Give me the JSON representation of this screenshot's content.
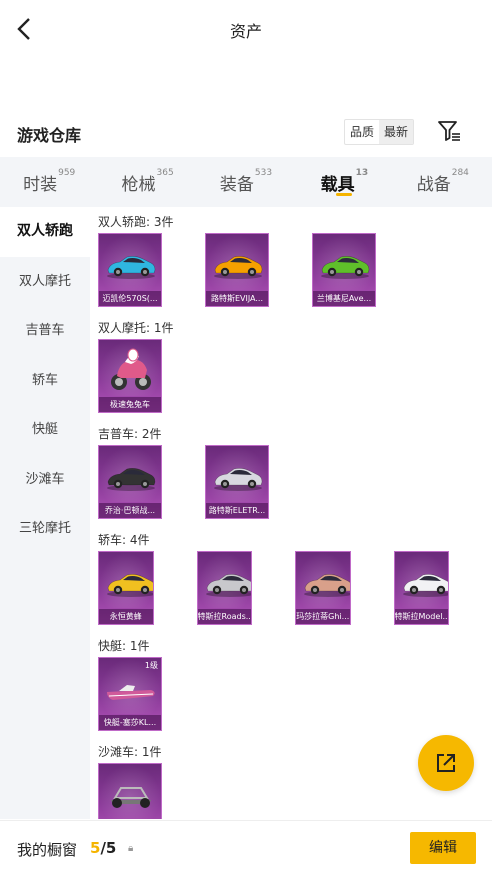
{
  "header": {
    "title": "资产"
  },
  "warehouse": {
    "title": "游戏仓库",
    "sort_options": [
      "品质",
      "最新"
    ]
  },
  "tabs": [
    {
      "label": "时装",
      "count": "959"
    },
    {
      "label": "枪械",
      "count": "365"
    },
    {
      "label": "装备",
      "count": "533"
    },
    {
      "label": "载具",
      "count": "13",
      "active": true
    },
    {
      "label": "战备",
      "count": "284"
    }
  ],
  "sidebar": {
    "items": [
      "双人轿跑",
      "双人摩托",
      "吉普车",
      "轿车",
      "快艇",
      "沙滩车",
      "三轮摩托"
    ],
    "active_index": 0
  },
  "sections": [
    {
      "title": "双人轿跑: 3件",
      "items": [
        {
          "label": "迈凯伦570S(...",
          "icon": "sports-car-icon",
          "color": "#2fb6e0"
        },
        {
          "label": "路特斯EVIJA...",
          "icon": "sports-car-icon",
          "color": "#f5a000"
        },
        {
          "label": "兰博基尼Ave...",
          "icon": "sports-car-icon",
          "color": "#5fbf2a"
        }
      ]
    },
    {
      "title": "双人摩托: 1件",
      "items": [
        {
          "label": "极速兔兔车",
          "icon": "motorcycle-icon",
          "color": "#e05a8a"
        }
      ]
    },
    {
      "title": "吉普车: 2件",
      "items": [
        {
          "label": "乔治·巴顿战...",
          "icon": "jeep-icon",
          "color": "#333333"
        },
        {
          "label": "路特斯ELETR...",
          "icon": "suv-icon",
          "color": "#d8d8e0"
        }
      ]
    },
    {
      "title": "轿车: 4件",
      "items": [
        {
          "label": "永恒黄蜂",
          "icon": "sports-car-icon",
          "color": "#f0c020"
        },
        {
          "label": "特斯拉Roads...",
          "icon": "sports-car-icon",
          "color": "#c8c8cc"
        },
        {
          "label": "玛莎拉蒂Ghi...",
          "icon": "sedan-icon",
          "color": "#d9a08a"
        },
        {
          "label": "特斯拉Model...",
          "icon": "sedan-icon",
          "color": "#f2f2f4"
        }
      ]
    },
    {
      "title": "快艇: 1件",
      "items": [
        {
          "label": "快艇-塞莎KL...",
          "icon": "speedboat-icon",
          "color": "#d05a9a",
          "level": "1级"
        }
      ]
    },
    {
      "title": "沙滩车: 1件",
      "items": [
        {
          "label": "",
          "icon": "buggy-icon",
          "color": "#bbbbbb"
        }
      ]
    }
  ],
  "bottom": {
    "label": "我的橱窗",
    "count_current": "5",
    "count_total": "/5",
    "edit_label": "编辑"
  },
  "colors": {
    "accent": "#f6b800",
    "card_bg": "#8c3c9a"
  }
}
